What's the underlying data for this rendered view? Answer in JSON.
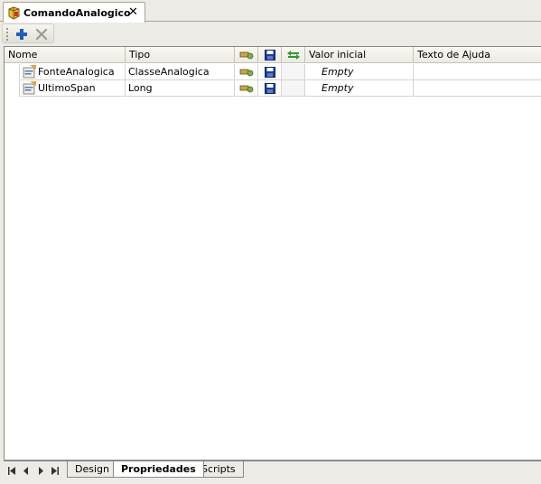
{
  "document_tab": {
    "title": "ComandoAnalogico",
    "close_glyph": "✕"
  },
  "toolbar": {
    "add_icon": "plus-icon",
    "delete_icon": "delete-x-icon"
  },
  "grid": {
    "columns": {
      "nome": "Nome",
      "tipo": "Tipo",
      "col3_icon": "key-icon",
      "col4_icon": "save-disk-icon",
      "col5_icon": "bidirectional-arrows-icon",
      "valor_inicial": "Valor inicial",
      "texto_ajuda": "Texto de Ajuda"
    },
    "rows": [
      {
        "nome": "FonteAnalogica",
        "tipo": "ClasseAnalogica",
        "valor_inicial": "Empty",
        "texto_ajuda": ""
      },
      {
        "nome": "UltimoSpan",
        "tipo": "Long",
        "valor_inicial": "Empty",
        "texto_ajuda": ""
      }
    ]
  },
  "bottom_tabs": {
    "items": [
      "Design",
      "Propriedades",
      "Scripts"
    ],
    "active": "Propriedades"
  },
  "colors": {
    "chrome": "#ecebe5",
    "accent_blue": "#1f5fc0",
    "save_blue": "#1b3f9c",
    "arrow_green": "#2f9a2f"
  }
}
